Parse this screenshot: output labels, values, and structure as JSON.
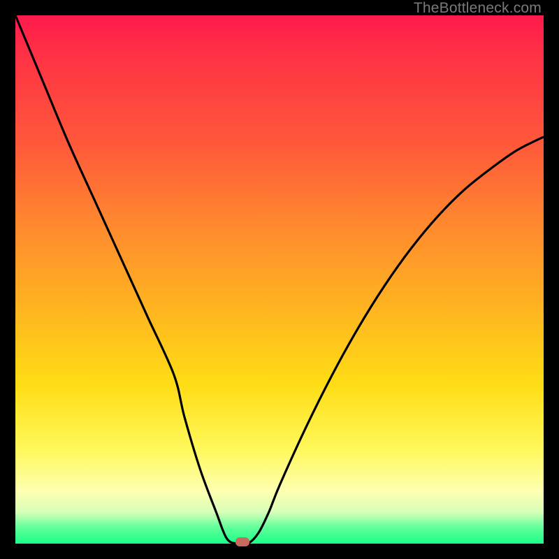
{
  "watermark": "TheBottleneck.com",
  "colors": {
    "frame": "#000000",
    "gradient_top": "#ff1a4d",
    "gradient_bottom": "#1aff88",
    "curve": "#000000",
    "marker": "#c96a5f"
  },
  "chart_data": {
    "type": "line",
    "title": "",
    "xlabel": "",
    "ylabel": "",
    "xlim": [
      0,
      100
    ],
    "ylim": [
      0,
      100
    ],
    "x": [
      0,
      5,
      10,
      15,
      20,
      25,
      30,
      32,
      35,
      38,
      40,
      42,
      44,
      46,
      48,
      50,
      55,
      60,
      65,
      70,
      75,
      80,
      85,
      90,
      95,
      100
    ],
    "values": [
      100,
      88,
      76,
      65,
      54,
      43,
      32,
      24,
      14,
      6,
      1,
      0,
      0,
      2,
      6,
      11,
      22,
      32,
      41,
      49,
      56,
      62,
      67,
      71,
      74.5,
      77
    ],
    "marker": {
      "x": 43,
      "y": 0
    },
    "series": [
      {
        "name": "bottleneck-curve",
        "x_ref": "x",
        "values_ref": "values"
      }
    ]
  }
}
